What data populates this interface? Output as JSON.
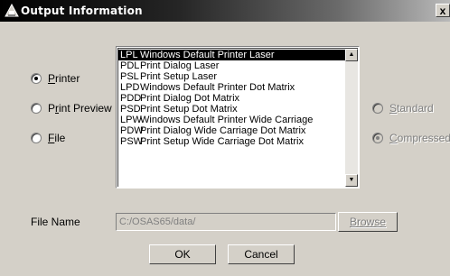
{
  "window": {
    "title": "Output Information",
    "close_label": "x"
  },
  "output_target": {
    "options": [
      {
        "label": "Printer",
        "checked": true
      },
      {
        "label": "Print Preview",
        "checked": false
      },
      {
        "label": "File",
        "checked": false
      }
    ]
  },
  "printer_list": {
    "items": [
      {
        "code": "LPL",
        "desc": "Windows Default Printer Laser",
        "selected": true
      },
      {
        "code": "PDL",
        "desc": "Print Dialog Laser",
        "selected": false
      },
      {
        "code": "PSL",
        "desc": "Print Setup Laser",
        "selected": false
      },
      {
        "code": "LPD",
        "desc": "Windows Default Printer Dot Matrix",
        "selected": false
      },
      {
        "code": "PDD",
        "desc": "Print Dialog Dot Matrix",
        "selected": false
      },
      {
        "code": "PSD",
        "desc": "Print Setup Dot Matrix",
        "selected": false
      },
      {
        "code": "LPW",
        "desc": "Windows Default Printer Wide Carriage",
        "selected": false
      },
      {
        "code": "PDW",
        "desc": "Print Dialog Wide Carriage Dot Matrix",
        "selected": false
      },
      {
        "code": "PSW",
        "desc": "Print Setup Wide Carriage Dot Matrix",
        "selected": false
      }
    ]
  },
  "print_mode": {
    "options": [
      {
        "label": "Standard",
        "checked": false
      },
      {
        "label": "Compressed",
        "checked": true
      }
    ]
  },
  "file_name": {
    "label": "File Name",
    "value": "C:/OSAS65/data/"
  },
  "buttons": {
    "browse": "Browse",
    "ok": "OK",
    "cancel": "Cancel"
  }
}
